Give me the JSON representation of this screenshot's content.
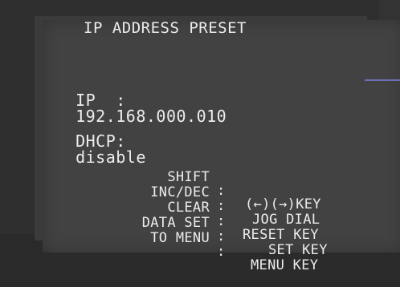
{
  "screen": {
    "title": "IP ADDRESS PRESET",
    "ip_label": "IP  :",
    "ip_value": "192.168.000.010",
    "dhcp_label": "DHCP:",
    "dhcp_value": "disable",
    "key_guide": [
      {
        "label": "SHIFT",
        "sep": ":",
        "value": "(←)(→)KEY"
      },
      {
        "label": "INC/DEC",
        "sep": ":",
        "value": "JOG DIAL"
      },
      {
        "label": "CLEAR",
        "sep": ":",
        "value": "RESET KEY"
      },
      {
        "label": "DATA SET",
        "sep": ":",
        "value": "SET KEY"
      },
      {
        "label": "TO MENU",
        "sep": ":",
        "value": "MENU KEY"
      }
    ]
  },
  "colors": {
    "text": "#ececec",
    "screen_bg": "#424242",
    "cable": "#6f6fb8"
  }
}
